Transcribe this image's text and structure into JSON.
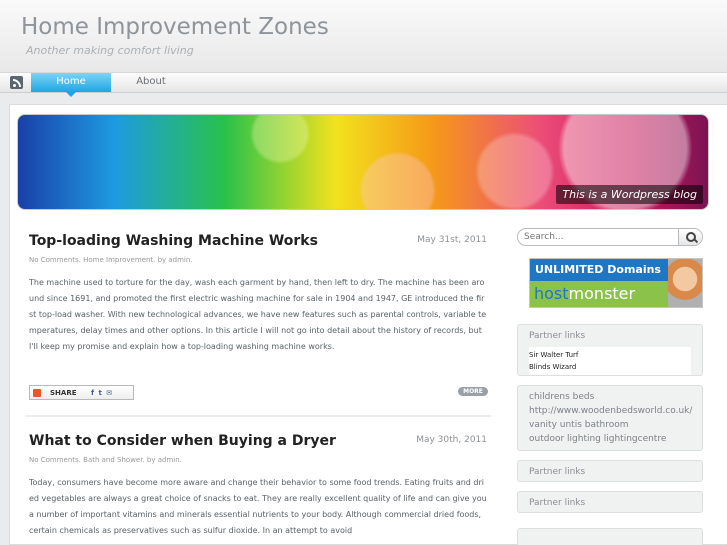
{
  "site": {
    "title": "Home Improvement Zones",
    "tagline": "Another making comfort living"
  },
  "nav": {
    "items": [
      {
        "label": "Home",
        "active": true
      },
      {
        "label": "About",
        "active": false
      }
    ]
  },
  "banner": {
    "caption": "This is a Wordpress blog"
  },
  "posts": [
    {
      "title": "Top-loading Washing Machine Works",
      "date": "May 31st, 2011",
      "meta": "No Comments. Home Improvement. by admin.",
      "body": "The machine used to torture for the day, wash each garment by hand, then left to dry. The machine has been around since 1691, and promoted the first electric washing machine for sale in 1904 and 1947, GE introduced the first top-load washer. With new technological advances, we have new features such as parental controls, variable temperatures, delay times and other options. In this article I will not go into detail about the history of records, but I'll keep my promise and explain how a top-loading washing machine works.",
      "share_label": "SHARE",
      "more_label": "MORE"
    },
    {
      "title": "What to Consider when Buying a Dryer",
      "date": "May 30th, 2011",
      "meta": "No Comments. Bath and Shower. by admin.",
      "body": "Today, consumers have become more aware and change their behavior to some food trends. Eating fruits and dried vegetables are always a great choice of snacks to eat. They are really excellent quality of life and can give you a number of important vitamins and minerals essential nutrients to your body. Although commercial dried foods, certain chemicals as preservatives such as sulfur dioxide. In an attempt to avoid"
    }
  ],
  "sidebar": {
    "search_placeholder": "Search...",
    "ad": {
      "headline": "UNLIMITED Domains",
      "brand_a": "host",
      "brand_b": "monster"
    },
    "partner_widget": {
      "title": "Partner links",
      "links": [
        "Sir Walter Turf",
        "Blinds Wizard"
      ]
    },
    "blogroll": [
      "childrens beds",
      "http://www.woodenbedsworld.co.uk/",
      "vanity untis bathroom",
      "outdoor lighting lightingcentre"
    ],
    "extra_widgets": [
      "Partner links",
      "Partner links"
    ]
  },
  "colors": {
    "accent": "#1ea6e3",
    "title_gray": "#8e9499"
  }
}
